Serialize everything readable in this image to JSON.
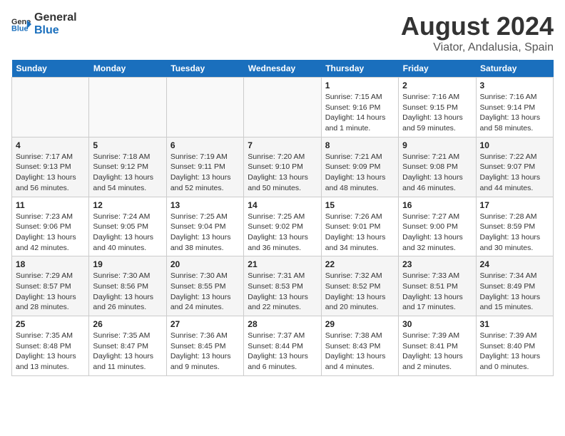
{
  "header": {
    "logo_line1": "General",
    "logo_line2": "Blue",
    "title": "August 2024",
    "subtitle": "Viator, Andalusia, Spain"
  },
  "days_of_week": [
    "Sunday",
    "Monday",
    "Tuesday",
    "Wednesday",
    "Thursday",
    "Friday",
    "Saturday"
  ],
  "weeks": [
    [
      {
        "day": "",
        "info": ""
      },
      {
        "day": "",
        "info": ""
      },
      {
        "day": "",
        "info": ""
      },
      {
        "day": "",
        "info": ""
      },
      {
        "day": "1",
        "info": "Sunrise: 7:15 AM\nSunset: 9:16 PM\nDaylight: 14 hours and 1 minute."
      },
      {
        "day": "2",
        "info": "Sunrise: 7:16 AM\nSunset: 9:15 PM\nDaylight: 13 hours and 59 minutes."
      },
      {
        "day": "3",
        "info": "Sunrise: 7:16 AM\nSunset: 9:14 PM\nDaylight: 13 hours and 58 minutes."
      }
    ],
    [
      {
        "day": "4",
        "info": "Sunrise: 7:17 AM\nSunset: 9:13 PM\nDaylight: 13 hours and 56 minutes."
      },
      {
        "day": "5",
        "info": "Sunrise: 7:18 AM\nSunset: 9:12 PM\nDaylight: 13 hours and 54 minutes."
      },
      {
        "day": "6",
        "info": "Sunrise: 7:19 AM\nSunset: 9:11 PM\nDaylight: 13 hours and 52 minutes."
      },
      {
        "day": "7",
        "info": "Sunrise: 7:20 AM\nSunset: 9:10 PM\nDaylight: 13 hours and 50 minutes."
      },
      {
        "day": "8",
        "info": "Sunrise: 7:21 AM\nSunset: 9:09 PM\nDaylight: 13 hours and 48 minutes."
      },
      {
        "day": "9",
        "info": "Sunrise: 7:21 AM\nSunset: 9:08 PM\nDaylight: 13 hours and 46 minutes."
      },
      {
        "day": "10",
        "info": "Sunrise: 7:22 AM\nSunset: 9:07 PM\nDaylight: 13 hours and 44 minutes."
      }
    ],
    [
      {
        "day": "11",
        "info": "Sunrise: 7:23 AM\nSunset: 9:06 PM\nDaylight: 13 hours and 42 minutes."
      },
      {
        "day": "12",
        "info": "Sunrise: 7:24 AM\nSunset: 9:05 PM\nDaylight: 13 hours and 40 minutes."
      },
      {
        "day": "13",
        "info": "Sunrise: 7:25 AM\nSunset: 9:04 PM\nDaylight: 13 hours and 38 minutes."
      },
      {
        "day": "14",
        "info": "Sunrise: 7:25 AM\nSunset: 9:02 PM\nDaylight: 13 hours and 36 minutes."
      },
      {
        "day": "15",
        "info": "Sunrise: 7:26 AM\nSunset: 9:01 PM\nDaylight: 13 hours and 34 minutes."
      },
      {
        "day": "16",
        "info": "Sunrise: 7:27 AM\nSunset: 9:00 PM\nDaylight: 13 hours and 32 minutes."
      },
      {
        "day": "17",
        "info": "Sunrise: 7:28 AM\nSunset: 8:59 PM\nDaylight: 13 hours and 30 minutes."
      }
    ],
    [
      {
        "day": "18",
        "info": "Sunrise: 7:29 AM\nSunset: 8:57 PM\nDaylight: 13 hours and 28 minutes."
      },
      {
        "day": "19",
        "info": "Sunrise: 7:30 AM\nSunset: 8:56 PM\nDaylight: 13 hours and 26 minutes."
      },
      {
        "day": "20",
        "info": "Sunrise: 7:30 AM\nSunset: 8:55 PM\nDaylight: 13 hours and 24 minutes."
      },
      {
        "day": "21",
        "info": "Sunrise: 7:31 AM\nSunset: 8:53 PM\nDaylight: 13 hours and 22 minutes."
      },
      {
        "day": "22",
        "info": "Sunrise: 7:32 AM\nSunset: 8:52 PM\nDaylight: 13 hours and 20 minutes."
      },
      {
        "day": "23",
        "info": "Sunrise: 7:33 AM\nSunset: 8:51 PM\nDaylight: 13 hours and 17 minutes."
      },
      {
        "day": "24",
        "info": "Sunrise: 7:34 AM\nSunset: 8:49 PM\nDaylight: 13 hours and 15 minutes."
      }
    ],
    [
      {
        "day": "25",
        "info": "Sunrise: 7:35 AM\nSunset: 8:48 PM\nDaylight: 13 hours and 13 minutes."
      },
      {
        "day": "26",
        "info": "Sunrise: 7:35 AM\nSunset: 8:47 PM\nDaylight: 13 hours and 11 minutes."
      },
      {
        "day": "27",
        "info": "Sunrise: 7:36 AM\nSunset: 8:45 PM\nDaylight: 13 hours and 9 minutes."
      },
      {
        "day": "28",
        "info": "Sunrise: 7:37 AM\nSunset: 8:44 PM\nDaylight: 13 hours and 6 minutes."
      },
      {
        "day": "29",
        "info": "Sunrise: 7:38 AM\nSunset: 8:43 PM\nDaylight: 13 hours and 4 minutes."
      },
      {
        "day": "30",
        "info": "Sunrise: 7:39 AM\nSunset: 8:41 PM\nDaylight: 13 hours and 2 minutes."
      },
      {
        "day": "31",
        "info": "Sunrise: 7:39 AM\nSunset: 8:40 PM\nDaylight: 13 hours and 0 minutes."
      }
    ]
  ]
}
